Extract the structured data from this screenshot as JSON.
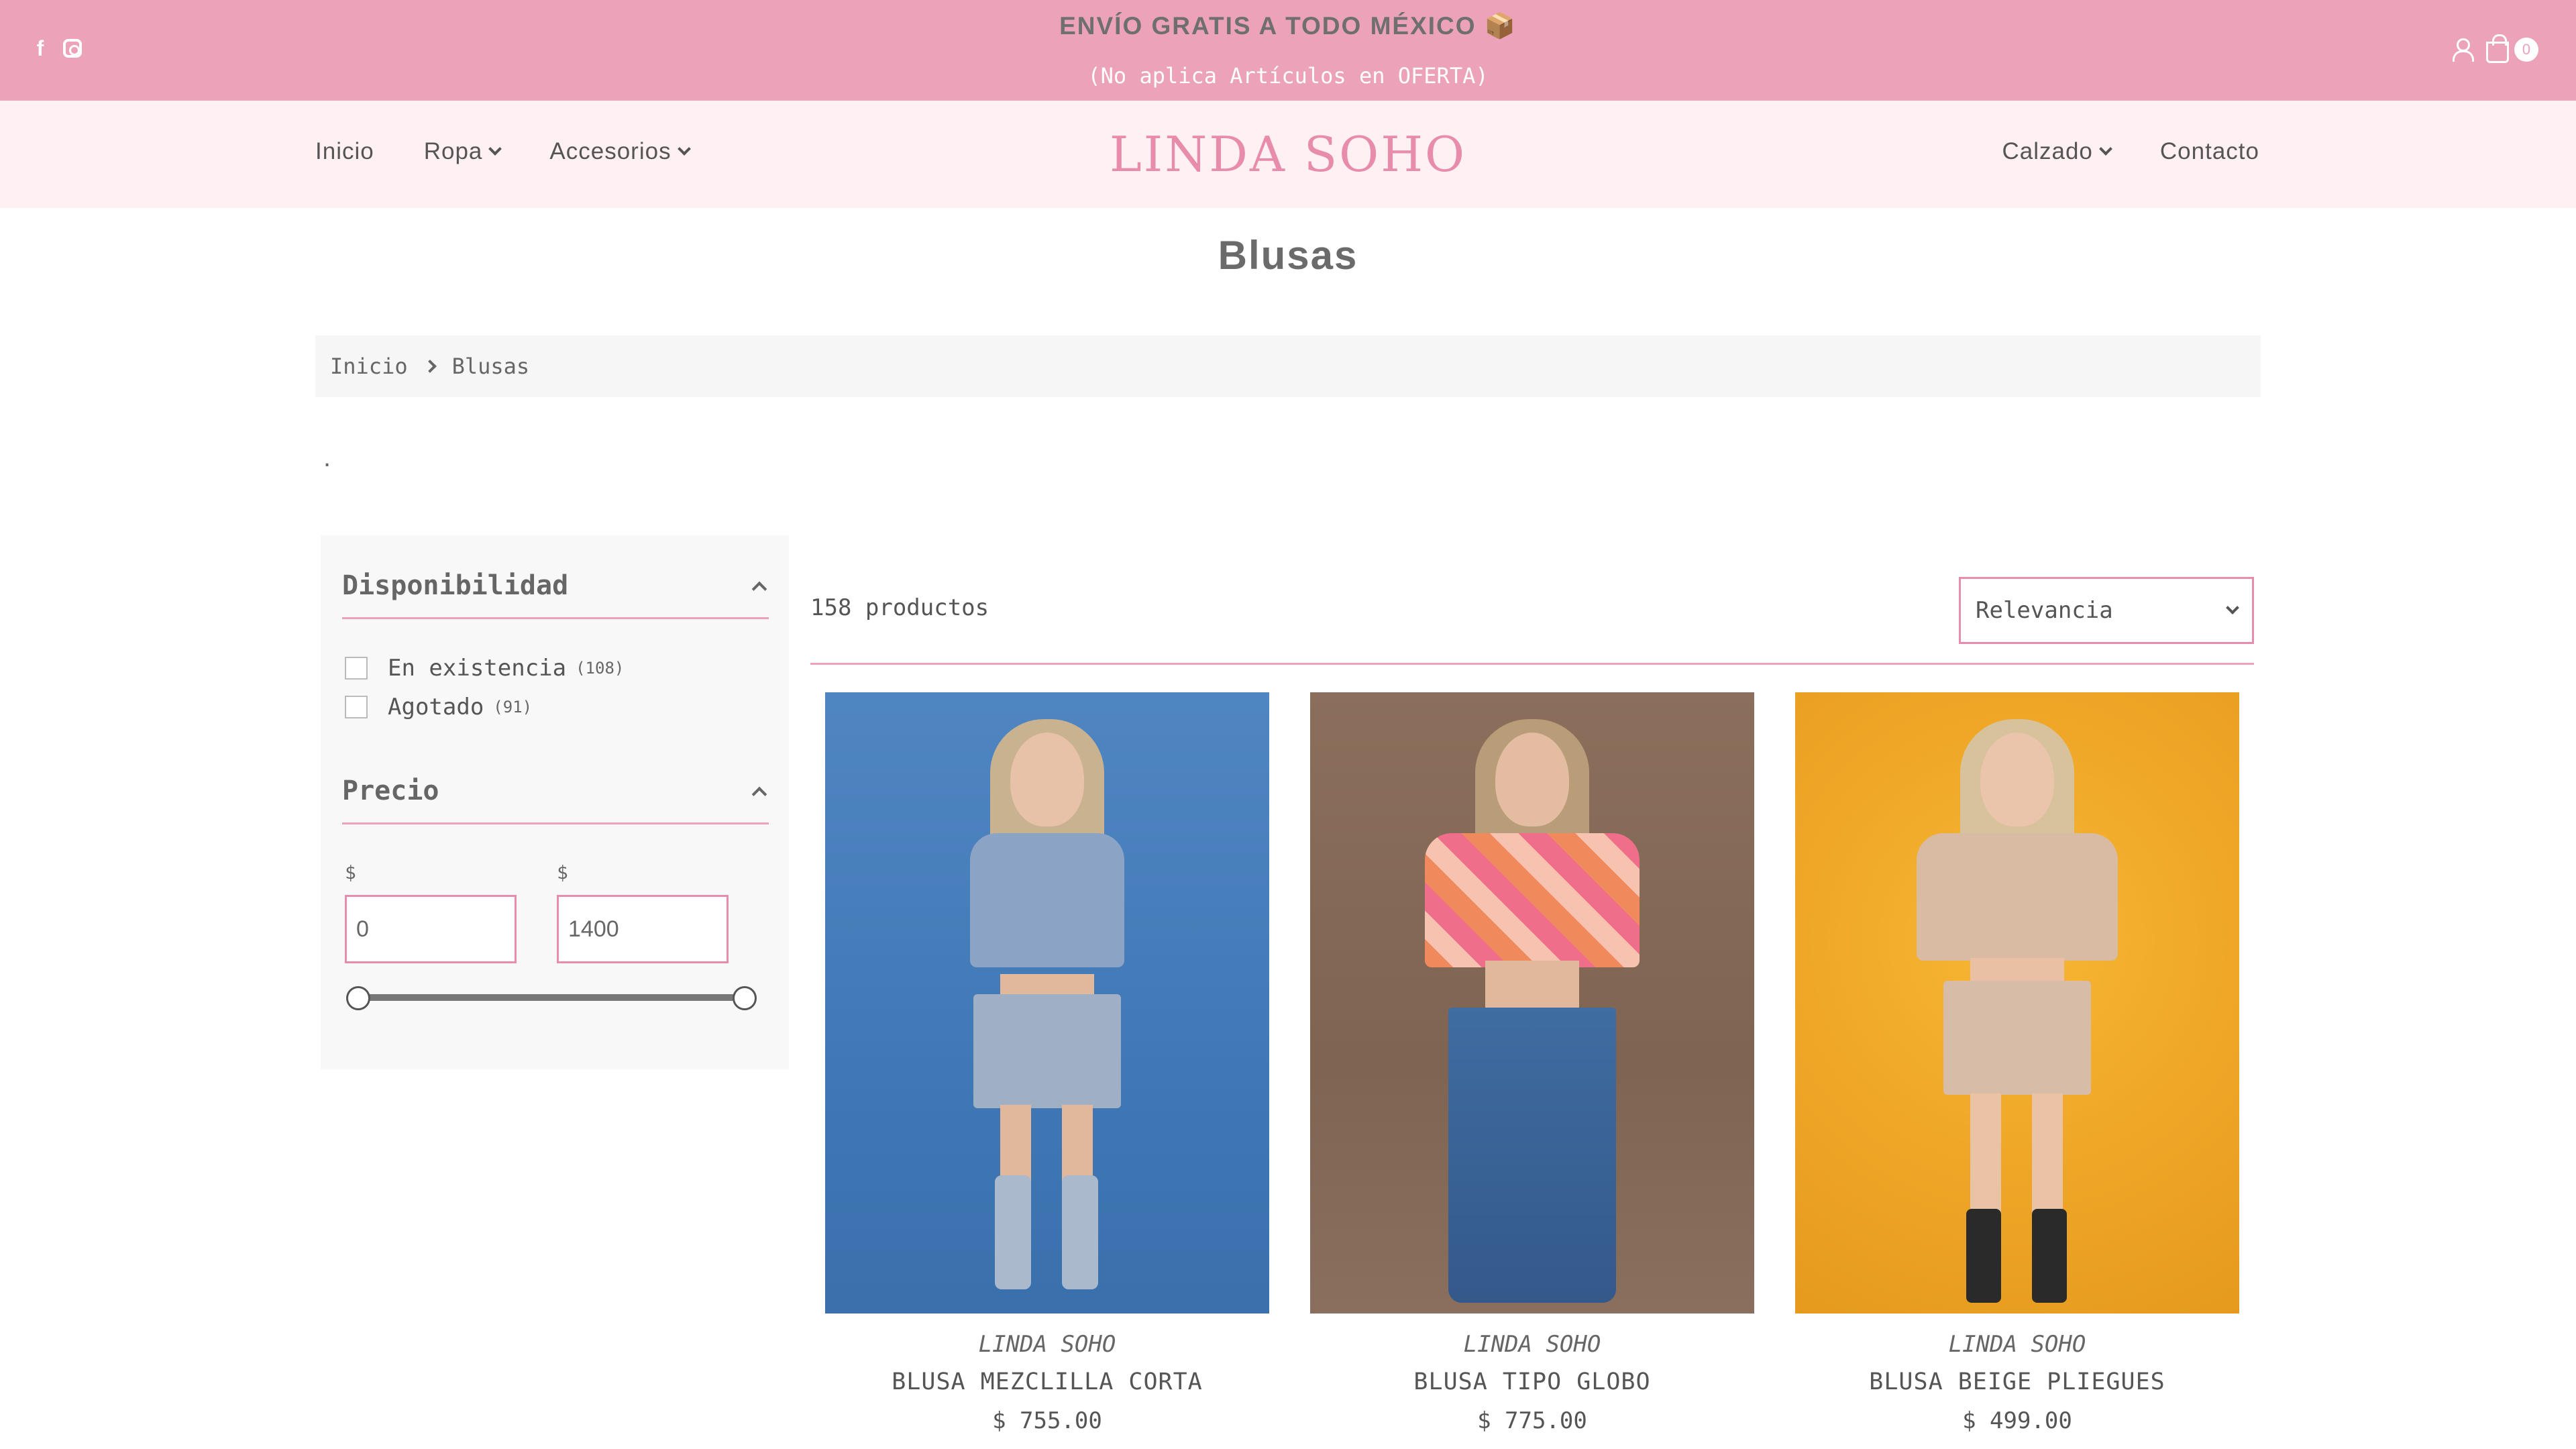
{
  "announcement": {
    "line1": "ENVÍO GRATIS A TODO MÉXICO 📦",
    "line2": "(No aplica Artículos en OFERTA)",
    "cart_count": "0",
    "social_icons": [
      "facebook-icon",
      "instagram-icon"
    ]
  },
  "header": {
    "logo": "LINDA SOHO",
    "nav_left": [
      {
        "label": "Inicio",
        "has_dropdown": false
      },
      {
        "label": "Ropa",
        "has_dropdown": true
      },
      {
        "label": "Accesorios",
        "has_dropdown": true
      }
    ],
    "nav_right": [
      {
        "label": "Calzado",
        "has_dropdown": true
      },
      {
        "label": "Contacto",
        "has_dropdown": false
      }
    ]
  },
  "page": {
    "title": "Blusas",
    "breadcrumb": [
      "Inicio",
      "Blusas"
    ],
    "description": "."
  },
  "filters": {
    "availability": {
      "title": "Disponibilidad",
      "options": [
        {
          "label": "En existencia",
          "count": "(108)",
          "checked": false
        },
        {
          "label": "Agotado",
          "count": "(91)",
          "checked": false
        }
      ]
    },
    "price": {
      "title": "Precio",
      "currency": "$",
      "min": "0",
      "max": "1400"
    }
  },
  "products_bar": {
    "count_text": "158 productos",
    "sort_selected": "Relevancia"
  },
  "products": [
    {
      "brand": "LINDA SOHO",
      "name": "BLUSA MEZCLILLA CORTA",
      "price": "$ 755.00"
    },
    {
      "brand": "LINDA SOHO",
      "name": "BLUSA TIPO GLOBO",
      "price": "$ 775.00"
    },
    {
      "brand": "LINDA SOHO",
      "name": "BLUSA BEIGE PLIEGUES",
      "price": "$ 499.00"
    }
  ],
  "colors": {
    "topbar": "#eca2b8",
    "header_bg": "#fff0f4",
    "logo": "#e88cab",
    "accent": "#eca2b8"
  }
}
